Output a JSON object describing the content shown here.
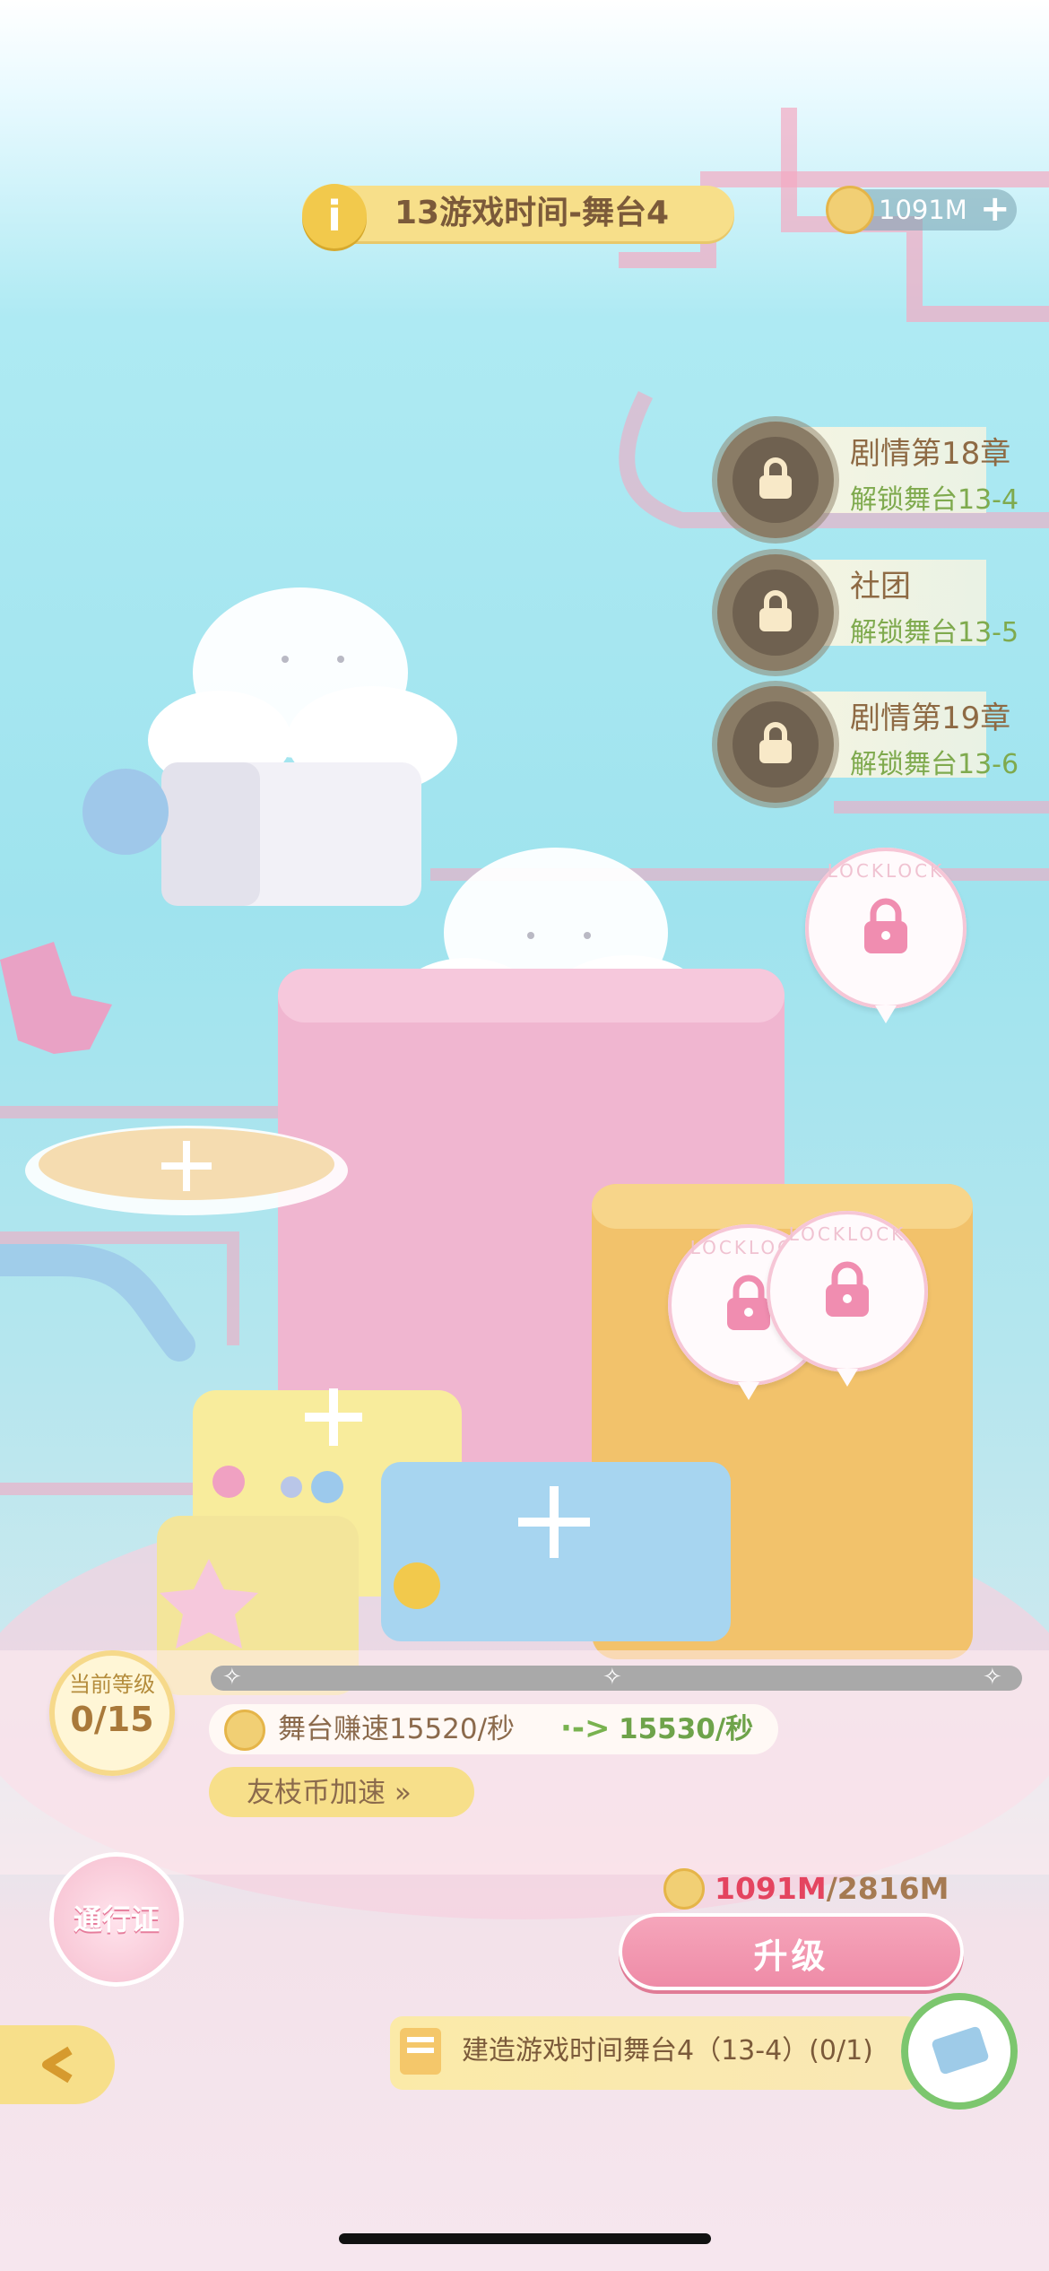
{
  "header": {
    "info_icon": "info-icon",
    "title": "13游戏时间-舞台4",
    "coins": "1091M",
    "coin_plus": "+"
  },
  "unlocks": [
    {
      "title": "剧情第18章",
      "subtitle": "解锁舞台13-4",
      "icon": "locked-camera-icon"
    },
    {
      "title": "社团",
      "subtitle": "解锁舞台13-5",
      "icon": "locked-cup-icon"
    },
    {
      "title": "剧情第19章",
      "subtitle": "解锁舞台13-6",
      "icon": "locked-camera-icon"
    }
  ],
  "lock_bubbles": [
    "LOCKLOCK",
    "LOCKLOCK",
    "LOCKLOCK"
  ],
  "panel": {
    "level_label": "当前等级",
    "level_value": "0/15",
    "level_progress": 0,
    "speed_text": "舞台赚速15520/秒",
    "speed_arrow": "·->",
    "speed_next": "15530/秒",
    "boost_label": "友枝币加速 »",
    "pass_label": "通行证",
    "cost_current": "1091M",
    "cost_total": "/2816M",
    "upgrade_label": "升级",
    "quest_text": "建造游戏时间舞台4（13-4）(0/1)"
  },
  "colors": {
    "cost_current": "#e4445f",
    "cost_total": "#a57a52",
    "accent_pink": "#ee8aa6",
    "accent_yellow": "#f7df8a"
  }
}
